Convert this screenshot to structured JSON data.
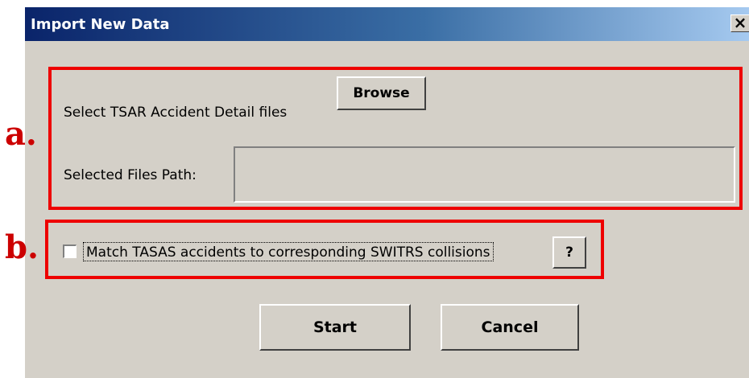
{
  "dialog": {
    "title": "Import New Data",
    "close_glyph": "×",
    "select_label": "Select TSAR Accident Detail files",
    "browse_label": "Browse",
    "path_label": "Selected Files Path:",
    "path_value": "",
    "match_label": "Match TASAS accidents to corresponding SWITRS collisions",
    "match_checked": false,
    "help_label": "?",
    "start_label": "Start",
    "cancel_label": "Cancel"
  },
  "annotations": {
    "a_label": "a.",
    "b_label": "b.",
    "highlight_color": "#ee0000"
  }
}
